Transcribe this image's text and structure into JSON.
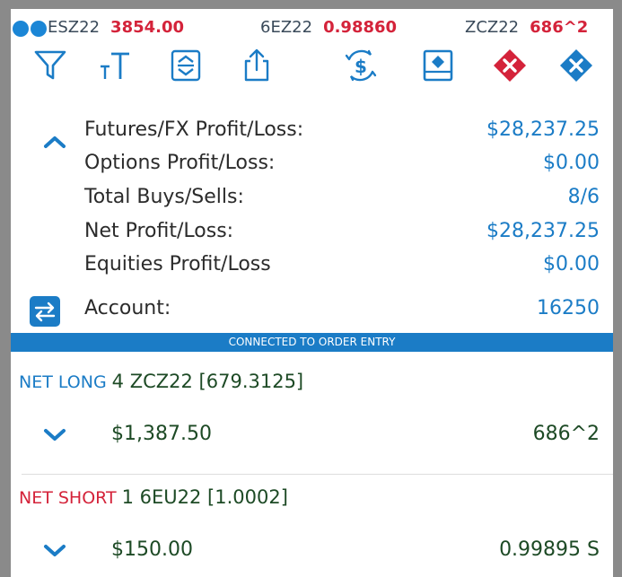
{
  "ticker": [
    {
      "symbol": "ESZ22",
      "price": "3854.00"
    },
    {
      "symbol": "6EZ22",
      "price": "0.98860"
    },
    {
      "symbol": "ZCZ22",
      "price": "686^2"
    }
  ],
  "colors": {
    "accent_blue": "#1b7cc6",
    "alert_red": "#d4233a",
    "position_green": "#1d4a25"
  },
  "toolbar": {
    "icons": [
      "filter-icon",
      "text-size-icon",
      "expand-collapse-icon",
      "share-icon",
      "currency-exchange-icon",
      "order-ticket-icon",
      "close-all-red-icon",
      "cancel-all-blue-icon"
    ]
  },
  "summary": [
    {
      "label": "Futures/FX Profit/Loss:",
      "value": "$28,237.25"
    },
    {
      "label": "Options Profit/Loss:",
      "value": "$0.00"
    },
    {
      "label": "Total Buys/Sells:",
      "value": "8/6"
    },
    {
      "label": "Net Profit/Loss:",
      "value": "$28,237.25"
    },
    {
      "label": "Equities Profit/Loss",
      "value": "$0.00"
    },
    {
      "label": "Account:",
      "value": "16250"
    }
  ],
  "connection_status": "CONNECTED TO ORDER ENTRY",
  "positions": [
    {
      "side": "NET LONG",
      "description": "4 ZCZ22 [679.3125]",
      "pl": "$1,387.50",
      "last": "686^2"
    },
    {
      "side": "NET SHORT",
      "description": "1 6EU22 [1.0002]",
      "pl": "$150.00",
      "last": "0.99895 S"
    }
  ]
}
